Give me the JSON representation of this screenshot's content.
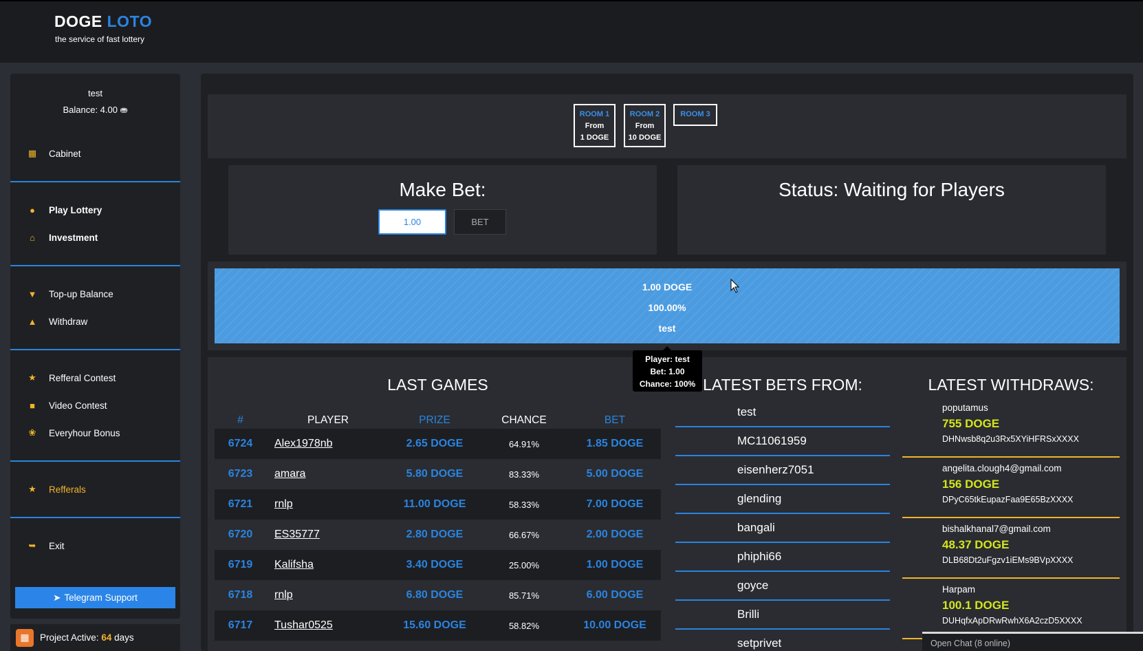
{
  "brand": {
    "name_part1": "DOGE",
    "name_part2": "LOTO",
    "tagline": "the service of fast lottery"
  },
  "user": {
    "name": "test",
    "balance_label": "Balance: 4.00"
  },
  "sidebar": {
    "groups": [
      [
        {
          "label": "Cabinet",
          "icon": "grid-icon"
        }
      ],
      [
        {
          "label": "Play Lottery",
          "icon": "palette-icon"
        },
        {
          "label": "Investment",
          "icon": "bank-icon"
        }
      ],
      [
        {
          "label": "Top-up Balance",
          "icon": "arrow-down-circle-icon"
        },
        {
          "label": "Withdraw",
          "icon": "arrow-up-circle-icon"
        }
      ],
      [
        {
          "label": "Refferal Contest",
          "icon": "trophy-icon"
        },
        {
          "label": "Video Contest",
          "icon": "video-icon"
        },
        {
          "label": "Everyhour Bonus",
          "icon": "gift-icon"
        }
      ],
      [
        {
          "label": "Refferals",
          "icon": "trophy-icon"
        }
      ],
      [
        {
          "label": "Exit",
          "icon": "sign-out-icon"
        }
      ]
    ],
    "telegram_label": "Telegram Support",
    "project_active_prefix": "Project Active:",
    "project_active_days": "64",
    "project_active_suffix": "days"
  },
  "rooms": [
    {
      "name": "ROOM 1",
      "line1": "From",
      "line2": "1 DOGE"
    },
    {
      "name": "ROOM 2",
      "line1": "From",
      "line2": "10 DOGE"
    },
    {
      "name": "ROOM 3"
    }
  ],
  "make_bet": {
    "title": "Make Bet:",
    "value": "1.00",
    "button": "BET"
  },
  "status": {
    "text": "Status: Waiting for Players"
  },
  "pot_bar": {
    "amount": "1.00 DOGE",
    "percent": "100.00%",
    "player": "test",
    "share": 1.0
  },
  "tooltip": {
    "line1": "Player: test",
    "line2": "Bet: 1.00",
    "line3": "Chance: 100%"
  },
  "last_games": {
    "title": "LAST GAMES",
    "headers": [
      "#",
      "PLAYER",
      "PRIZE",
      "CHANCE",
      "BET"
    ],
    "rows": [
      {
        "id": "6724",
        "player": "Alex1978nb",
        "prize": "2.65 DOGE",
        "chance": "64.91%",
        "bet": "1.85 DOGE"
      },
      {
        "id": "6723",
        "player": "amara",
        "prize": "5.80 DOGE",
        "chance": "83.33%",
        "bet": "5.00 DOGE"
      },
      {
        "id": "6721",
        "player": "rnlp",
        "prize": "11.00 DOGE",
        "chance": "58.33%",
        "bet": "7.00 DOGE"
      },
      {
        "id": "6720",
        "player": "ES35777",
        "prize": "2.80 DOGE",
        "chance": "66.67%",
        "bet": "2.00 DOGE"
      },
      {
        "id": "6719",
        "player": "Kalifsha",
        "prize": "3.40 DOGE",
        "chance": "25.00%",
        "bet": "1.00 DOGE"
      },
      {
        "id": "6718",
        "player": "rnlp",
        "prize": "6.80 DOGE",
        "chance": "85.71%",
        "bet": "6.00 DOGE"
      },
      {
        "id": "6717",
        "player": "Tushar0525",
        "prize": "15.60 DOGE",
        "chance": "58.82%",
        "bet": "10.00 DOGE"
      }
    ]
  },
  "latest_bets": {
    "title": "LATEST BETS FROM:",
    "items": [
      "test",
      "MC11061959",
      "eisenherz7051",
      "glending",
      "bangali",
      "phiphi66",
      "goyce",
      "Brilli",
      "setprivet"
    ]
  },
  "latest_withdraws": {
    "title": "LATEST WITHDRAWS:",
    "items": [
      {
        "name": "poputamus",
        "amount": "755 DOGE",
        "address": "DHNwsb8q2u3Rx5XYiHFRSxXXXX"
      },
      {
        "name": "angelita.clough4@gmail.com",
        "amount": "156 DOGE",
        "address": "DPyC65tkEupazFaa9E65BzXXXX"
      },
      {
        "name": "bishalkhanal7@gmail.com",
        "amount": "48.37 DOGE",
        "address": "DLB68Dt2uFgzv1iEMs9BVpXXXX"
      },
      {
        "name": "Harpam",
        "amount": "100.1 DOGE",
        "address": "DUHqfxApDRwRwhX6A2czD5XXXX"
      }
    ]
  },
  "chat": {
    "label": "Open Chat (8 online)"
  },
  "colors": {
    "accent": "#2a84e0",
    "gold": "#f0b429",
    "amount": "#d4e61a",
    "bar": "#4b9be0"
  }
}
